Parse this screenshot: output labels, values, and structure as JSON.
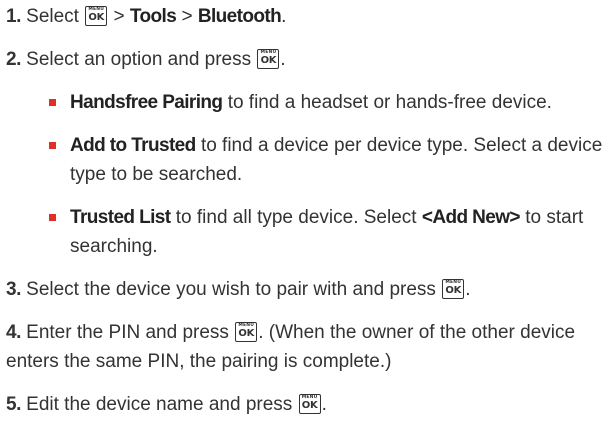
{
  "key": {
    "top": "MENU",
    "bottom": "OK"
  },
  "steps": {
    "s1": {
      "num": "1.",
      "t1": "Select",
      "t2": ">",
      "menu1": "Tools",
      "t3": ">",
      "menu2": "Bluetooth",
      "t4": "."
    },
    "s2": {
      "num": "2.",
      "t1": "Select an option and press",
      "t2": "."
    },
    "b1": {
      "bold": "Handsfree Pairing",
      "text": "to find a headset or hands-free device."
    },
    "b2": {
      "bold": "Add to Trusted",
      "text": "to find a device per device type. Select a device type to be searched."
    },
    "b3": {
      "bold": "Trusted List",
      "t1": "to find all type device. Select",
      "bold2": "<Add New>",
      "t2": "to start searching."
    },
    "s3": {
      "num": "3.",
      "t1": "Select the device you wish to pair with and press",
      "t2": "."
    },
    "s4": {
      "num": "4.",
      "t1": "Enter the PIN and press",
      "t2": ". (When the owner of the other device enters the same PIN, the pairing is complete.)"
    },
    "s5": {
      "num": "5.",
      "t1": "Edit the device name and press",
      "t2": "."
    }
  },
  "colors": {
    "text": "#333333",
    "bullet": "#e03027"
  }
}
